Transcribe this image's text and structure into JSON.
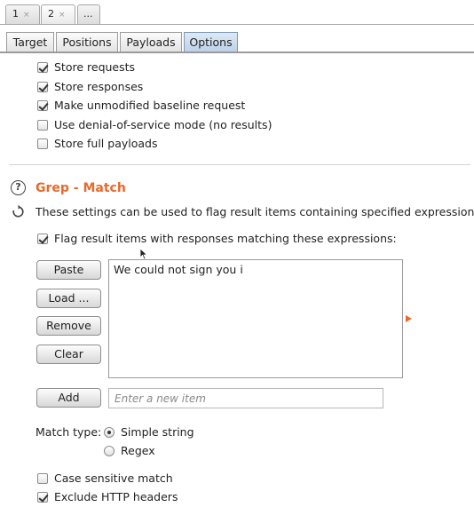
{
  "top_tabs": [
    {
      "label": "1",
      "close": "×"
    },
    {
      "label": "2",
      "close": "×"
    },
    {
      "label": "..."
    }
  ],
  "section_tabs": [
    "Target",
    "Positions",
    "Payloads",
    "Options"
  ],
  "active_section_tab": "Options",
  "store_options": [
    {
      "label": "Store requests",
      "checked": true
    },
    {
      "label": "Store responses",
      "checked": true
    },
    {
      "label": "Make unmodified baseline request",
      "checked": true
    },
    {
      "label": "Use denial-of-service mode (no results)",
      "checked": false
    },
    {
      "label": "Store full payloads",
      "checked": false
    }
  ],
  "grep_match": {
    "title": "Grep - Match",
    "description": "These settings can be used to flag result items containing specified expressions.",
    "flag_label": "Flag result items with responses matching these expressions:",
    "flag_checked": true,
    "buttons": {
      "paste": "Paste",
      "load": "Load ...",
      "remove": "Remove",
      "clear": "Clear",
      "add": "Add"
    },
    "items": [
      "We could not sign you i"
    ],
    "new_item_placeholder": "Enter a new item",
    "match_type_label": "Match type:",
    "match_types": [
      {
        "label": "Simple string",
        "selected": true
      },
      {
        "label": "Regex",
        "selected": false
      }
    ],
    "case_sensitive_label": "Case sensitive match",
    "case_sensitive_checked": false,
    "exclude_headers_label": "Exclude HTTP headers",
    "exclude_headers_checked": true
  },
  "colors": {
    "accent": "#e8692d",
    "active_tab": "#bcd1e8"
  }
}
